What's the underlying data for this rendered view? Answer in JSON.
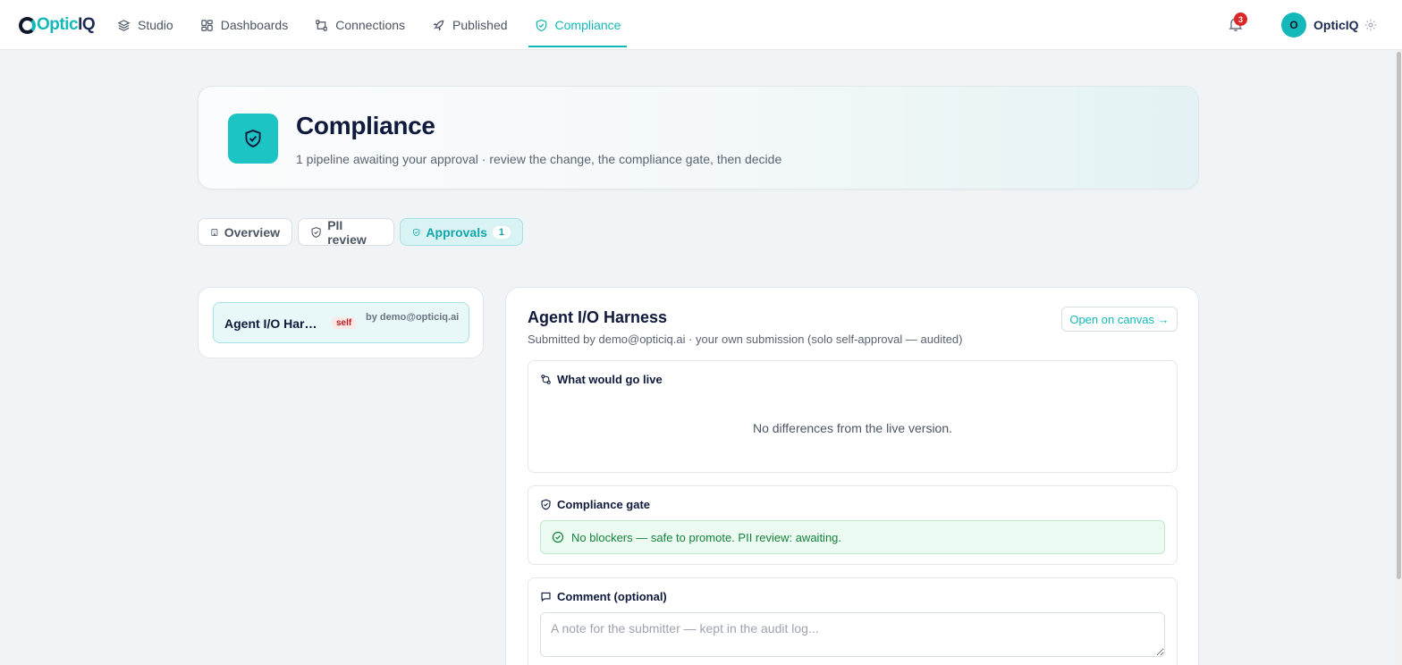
{
  "app": {
    "logo_part1": "Optic",
    "logo_part2": "IQ"
  },
  "nav": {
    "items": [
      {
        "label": "Studio",
        "icon": "layers-icon"
      },
      {
        "label": "Dashboards",
        "icon": "dashboard-icon"
      },
      {
        "label": "Connections",
        "icon": "connections-icon"
      },
      {
        "label": "Published",
        "icon": "rocket-icon"
      },
      {
        "label": "Compliance",
        "icon": "shield-icon",
        "active": true
      }
    ]
  },
  "user": {
    "notifications": "3",
    "avatar_initial": "O",
    "name": "OpticIQ"
  },
  "hero": {
    "title": "Compliance",
    "subtitle": "1 pipeline awaiting your approval · review the change, the compliance gate, then decide"
  },
  "tabs": [
    {
      "label": "Overview"
    },
    {
      "label": "PII review"
    },
    {
      "label": "Approvals",
      "count": "1",
      "active": true
    }
  ],
  "approvals": [
    {
      "title": "Agent I/O Harness",
      "badge": "self",
      "by": "by demo@opticiq.ai"
    }
  ],
  "detail": {
    "title": "Agent I/O Harness",
    "subtitle": "Submitted by demo@opticiq.ai · your own submission (solo self-approval — audited)",
    "open_label": "Open on canvas →",
    "diff_heading": "What would go live",
    "diff_empty": "No differences from the live version.",
    "gate_heading": "Compliance gate",
    "gate_status": "No blockers — safe to promote. PII review: awaiting.",
    "comment_heading": "Comment (optional)",
    "comment_placeholder": "A note for the submitter — kept in the audit log...",
    "comment_value": ""
  },
  "colors": {
    "accent": "#14b8b8",
    "success": "#15803d",
    "danger": "#dc2626",
    "navy": "#0f1a3c"
  }
}
